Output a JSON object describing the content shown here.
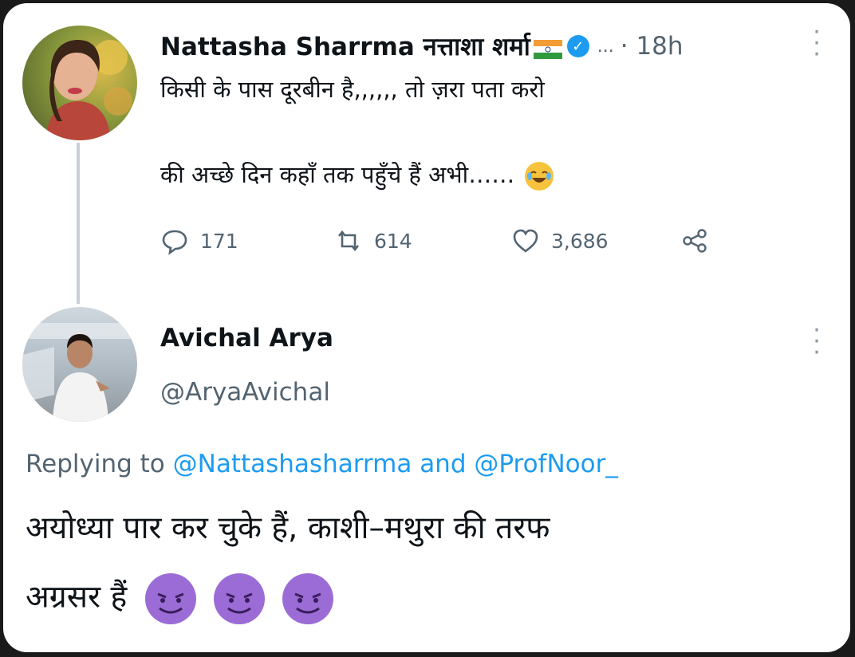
{
  "tweet": {
    "author_name": "Nattasha Sharrma नत्ताशा शर्मा",
    "more_dots": "...",
    "time": "· 18h",
    "text_line1": "किसी के पास दूरबीन है,,,,,, तो ज़रा पता करो",
    "text_line2": "की अच्छे दिन कहाँ तक पहुँचे हैं अभी……",
    "stats": {
      "replies": "171",
      "retweets": "614",
      "likes": "3,686"
    },
    "icons": [
      "flag-india-icon",
      "verified-icon",
      "more-icon",
      "laughing-emoji-icon",
      "reply-icon",
      "retweet-icon",
      "like-icon",
      "share-icon"
    ]
  },
  "reply": {
    "author_name": "Avichal Arya",
    "author_handle": "@AryaAvichal",
    "replying_prefix": "Replying to",
    "replying_user1": "@Nattashasharrma",
    "replying_and": "and",
    "replying_user2": "@ProfNoor_",
    "text_line1": "अयोध्या पार कर चुके हैं, काशी–मथुरा की तरफ",
    "text_line2": "अग्रसर हैं",
    "emoji_icons": [
      "smiling-devil-emoji-icon",
      "smiling-devil-emoji-icon",
      "smiling-devil-emoji-icon"
    ]
  },
  "colors": {
    "text": "#0f1419",
    "secondary": "#536471",
    "link": "#1d9bf0",
    "verified": "#1d9bf0"
  }
}
